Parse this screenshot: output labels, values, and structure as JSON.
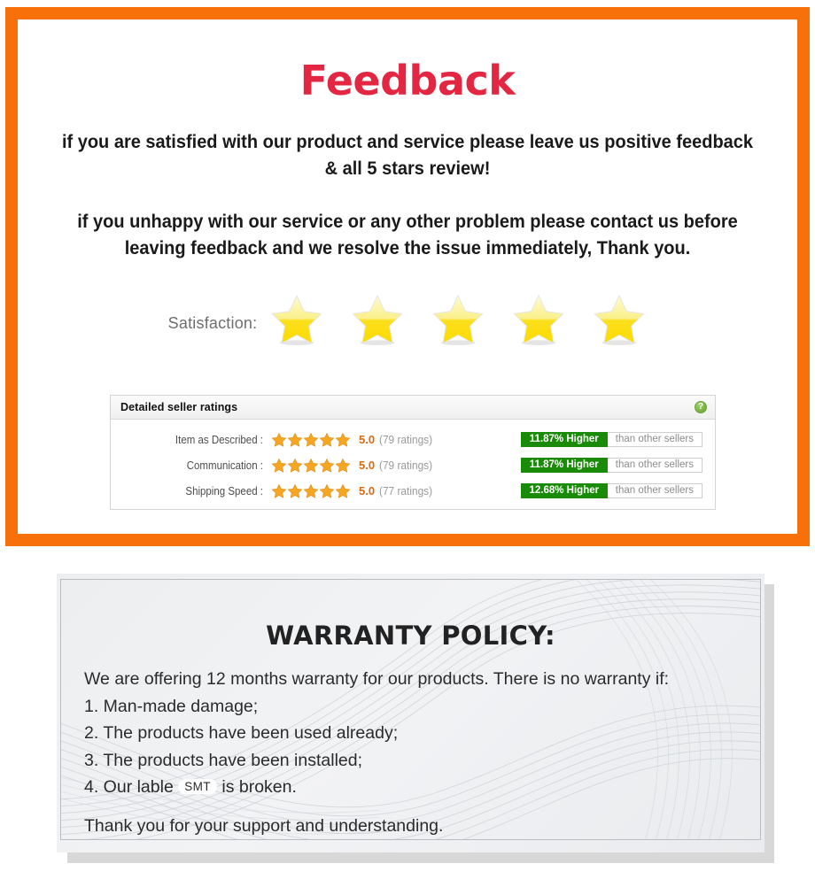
{
  "feedback": {
    "title": "Feedback",
    "title_color": "#e32641",
    "frame_color": "#f7700a",
    "paragraph_1": "if you are satisfied with our product and service please leave us positive feedback & all 5 stars review!",
    "paragraph_2": "if you unhappy with our service or any other problem please contact us before leaving feedback and we resolve the issue immediately, Thank you.",
    "satisfaction_label": "Satisfaction:",
    "satisfaction_stars": 5,
    "ratings_box": {
      "header": "Detailed seller ratings",
      "help_icon": "question-mark-icon",
      "help_glyph": "?",
      "columns": [
        "criterion",
        "stars",
        "score",
        "count",
        "comparison",
        "comparison_suffix"
      ],
      "rows": [
        {
          "label": "Item as Described :",
          "stars": 5,
          "score": "5.0",
          "count": "(79 ratings)",
          "compare_value": "11.87% Higher",
          "compare_suffix": "than other sellers"
        },
        {
          "label": "Communication :",
          "stars": 5,
          "score": "5.0",
          "count": "(79 ratings)",
          "compare_value": "11.87% Higher",
          "compare_suffix": "than other sellers"
        },
        {
          "label": "Shipping Speed :",
          "stars": 5,
          "score": "5.0",
          "count": "(77 ratings)",
          "compare_value": "12.68% Higher",
          "compare_suffix": "than other sellers"
        }
      ],
      "green_color": "#1a8a09",
      "score_color": "#d56a13"
    }
  },
  "warranty": {
    "title": "WARRANTY POLICY:",
    "intro": "We are offering 12 months warranty for our products. There is no warranty if:",
    "item_1": "1. Man-made damage;",
    "item_2": "2. The products have been used already;",
    "item_3": "3. The products have been installed;",
    "item_4_prefix": "4. Our lable",
    "item_4_badge": "SMT",
    "item_4_suffix": "is broken.",
    "closing": "Thank you for your support and understanding."
  }
}
